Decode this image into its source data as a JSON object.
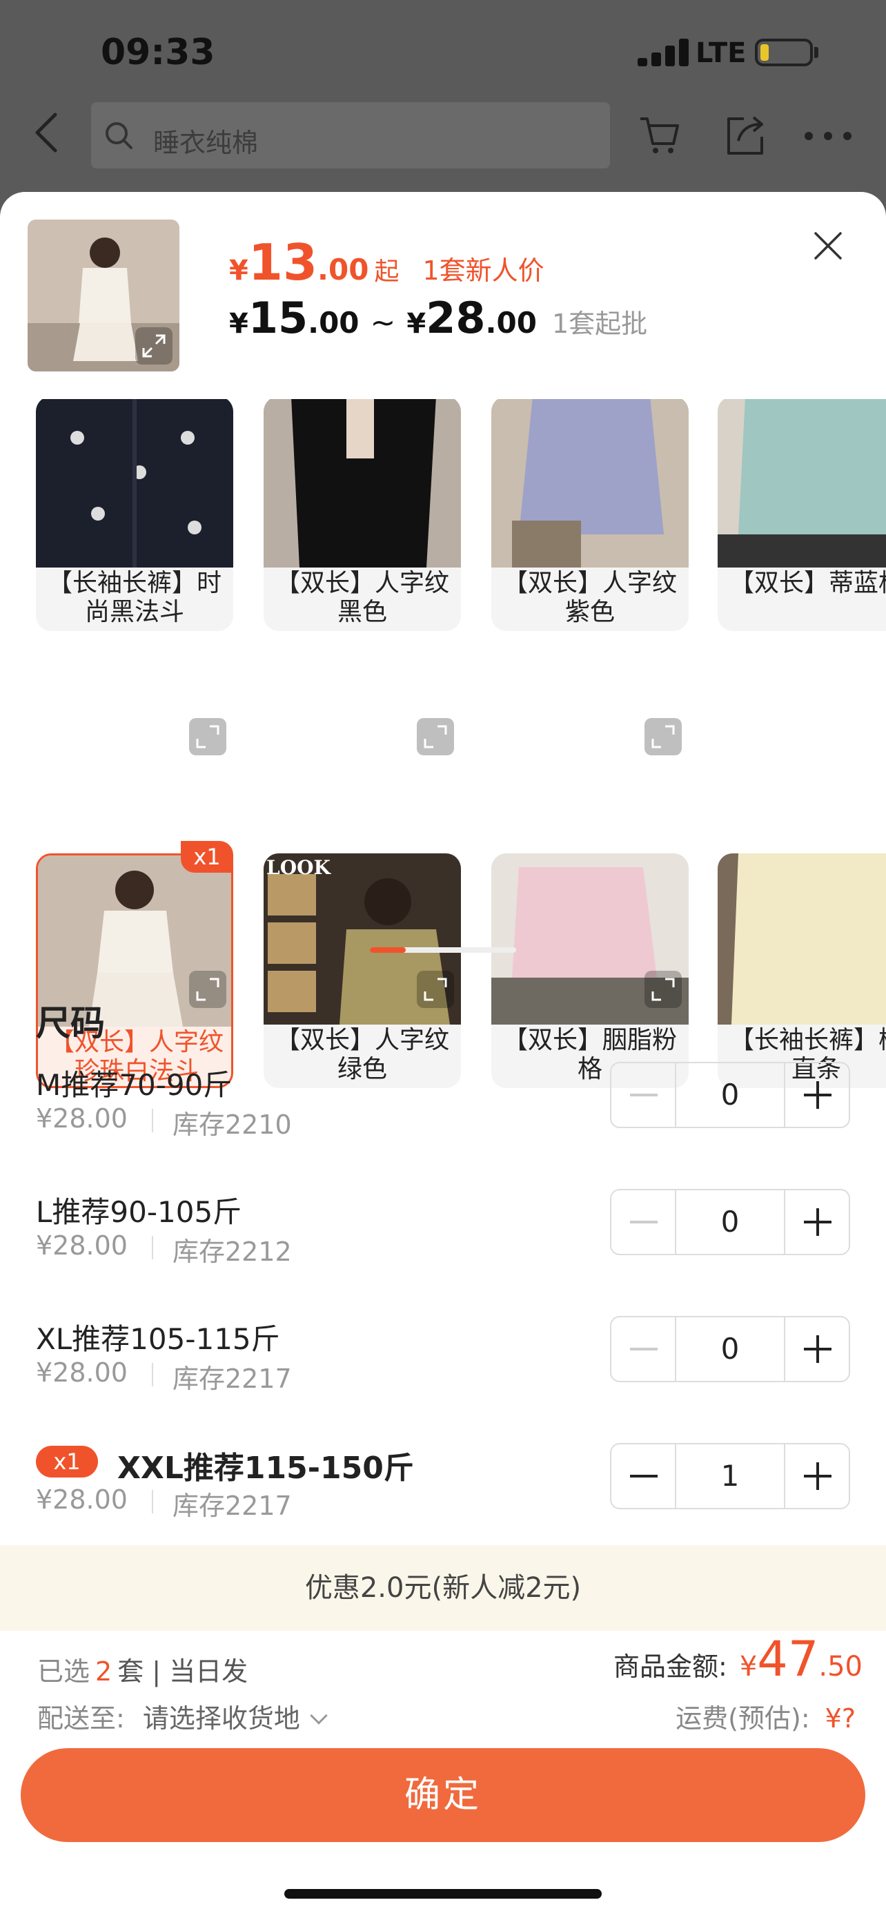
{
  "status_bar": {
    "time": "09:33",
    "network": "LTE"
  },
  "header": {
    "search_placeholder": "睡衣纯棉"
  },
  "product": {
    "price_currency": "¥",
    "new_price_int": "13",
    "new_price_dec": ".00",
    "new_price_suffix": "起",
    "new_price_note": "1套新人价",
    "range_low_int": "15",
    "range_low_dec": ".00",
    "range_sep": "~",
    "range_high_int": "28",
    "range_high_dec": ".00",
    "min_order": "1套起批"
  },
  "variants": [
    {
      "label": "【长袖长裤】时尚黑法斗",
      "selected": false,
      "icon": "pajama-photo-black-print"
    },
    {
      "label": "【双长】人字纹黑色",
      "selected": false,
      "icon": "pajama-photo-black"
    },
    {
      "label": "【双长】人字纹紫色",
      "selected": false,
      "icon": "pajama-photo-purple"
    },
    {
      "label": "【双长】蒂蓝格",
      "selected": false,
      "icon": "pajama-photo-blue"
    },
    {
      "label": "【双长】人字纹珍珠白法斗",
      "selected": true,
      "badge": "x1",
      "icon": "pajama-photo-white"
    },
    {
      "label": "【双长】人字纹绿色",
      "selected": false,
      "icon": "pajama-photo-green",
      "overlay_text": "LOOK"
    },
    {
      "label": "【双长】胭脂粉格",
      "selected": false,
      "icon": "pajama-photo-pink"
    },
    {
      "label": "【长袖长裤】槟直条",
      "selected": false,
      "icon": "pajama-photo-cream"
    }
  ],
  "sizes": {
    "title": "尺码",
    "rows": [
      {
        "name": "M推荐70-90斤",
        "price": "¥28.00",
        "stock": "库存2210",
        "qty": "0"
      },
      {
        "name": "L推荐90-105斤",
        "price": "¥28.00",
        "stock": "库存2212",
        "qty": "0"
      },
      {
        "name": "XL推荐105-115斤",
        "price": "¥28.00",
        "stock": "库存2217",
        "qty": "0"
      },
      {
        "name": "XXL推荐115-150斤",
        "price": "¥28.00",
        "stock": "库存2217",
        "qty": "1",
        "badge": "x1"
      }
    ]
  },
  "promo": {
    "text": "优惠2.0元(新人减2元)"
  },
  "summary": {
    "selected_prefix": "已选",
    "selected_count": "2",
    "selected_suffix": "套 | 当日发",
    "ship_to_label": "配送至:",
    "ship_to_value": "请选择收货地",
    "amount_label": "商品金额:",
    "amount_currency": "¥",
    "amount_int": "47",
    "amount_dec": ".50",
    "freight_label": "运费(预估):",
    "freight_value": "¥?"
  },
  "confirm_label": "确定",
  "colors": {
    "accent": "#f0532b",
    "button": "#f06a3d",
    "promo_bg": "#fbf6ea"
  }
}
